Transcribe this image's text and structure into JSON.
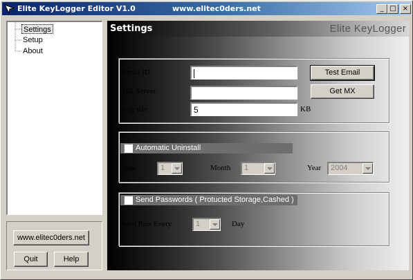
{
  "window": {
    "title": "Elite KeyLogger Editor V1.0",
    "url": "www.elitec0ders.net",
    "controls": {
      "minimize": "_",
      "maximize": "□",
      "close": "×"
    }
  },
  "tree": {
    "items": [
      {
        "label": "Settings",
        "selected": true
      },
      {
        "label": "Setup",
        "selected": false
      },
      {
        "label": "About",
        "selected": false
      }
    ]
  },
  "left_buttons": {
    "website": "www.elitec0ders.net",
    "quit": "Quit",
    "help": "Help"
  },
  "panel": {
    "title": "Settings",
    "brand": "Elite KeyLogger"
  },
  "email_group": {
    "email_label": "Email ID",
    "email_value": "",
    "mx_label": "MX Server",
    "mx_value": "",
    "logsize_label": "Log size",
    "logsize_value": "5",
    "logsize_unit": "KB",
    "test_email_button": "Test Email",
    "get_mx_button": "Get MX"
  },
  "uninstall_group": {
    "checkbox_label": "Automatic Uninstall",
    "checked": false,
    "date_label": "Date",
    "date_value": "1",
    "month_label": "Month",
    "month_value": "1",
    "year_label": "Year",
    "year_value": "2004"
  },
  "passwords_group": {
    "checkbox_label": "Send Passwords ( Protucted Storage,Cashed )",
    "checked": false,
    "every_label": "Send Pass Every",
    "every_value": "1",
    "day_label": "Day"
  },
  "colors": {
    "titlebar_start": "#0a246a",
    "titlebar_end": "#a6caf0",
    "window_face": "#d4d0c8"
  }
}
